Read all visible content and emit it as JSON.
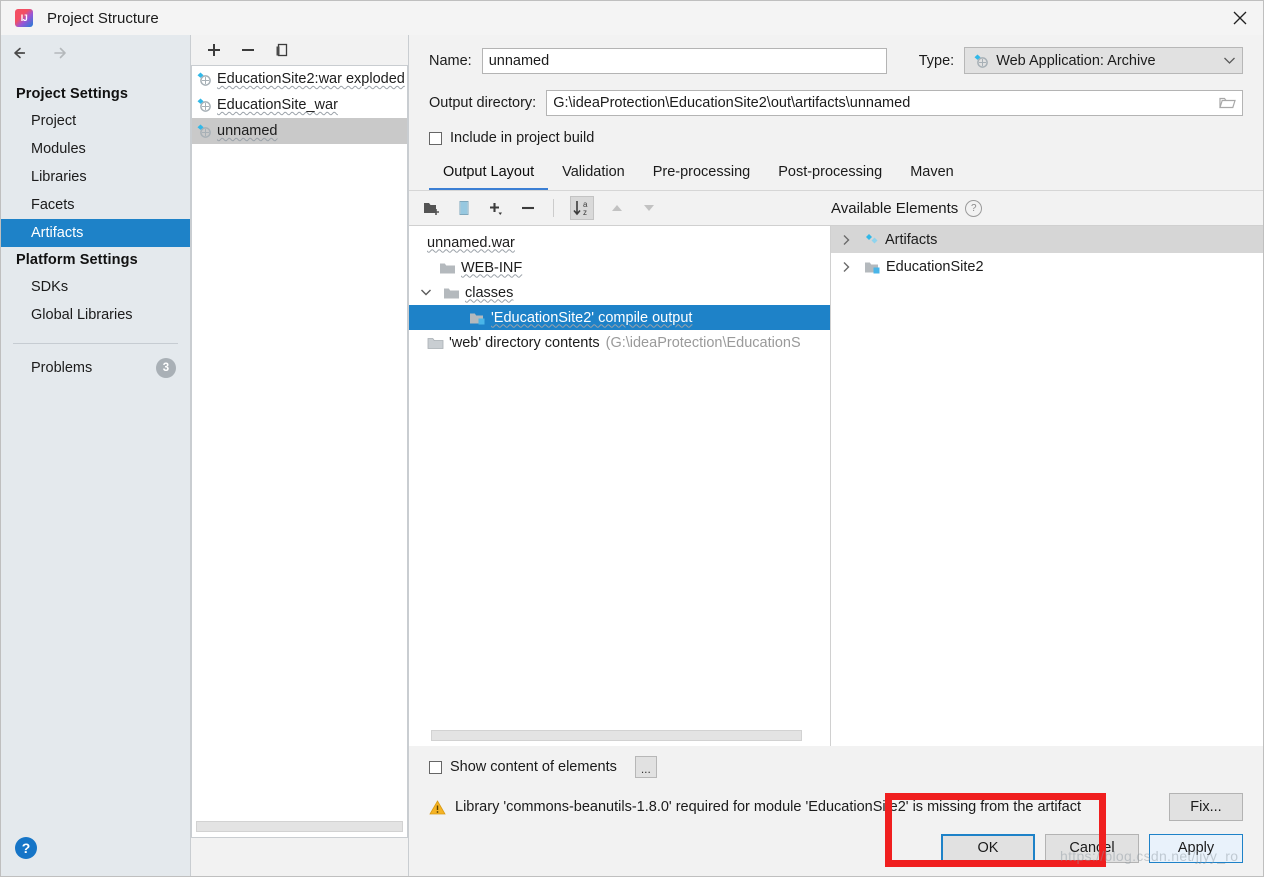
{
  "window": {
    "title": "Project Structure",
    "app_icon": "intellij-idea-icon",
    "close_label": "×"
  },
  "sidebar": {
    "back_label": "Back",
    "forward_label": "Forward",
    "groups": [
      {
        "title": "Project Settings",
        "items": [
          {
            "label": "Project",
            "selected": false
          },
          {
            "label": "Modules",
            "selected": false
          },
          {
            "label": "Libraries",
            "selected": false
          },
          {
            "label": "Facets",
            "selected": false
          },
          {
            "label": "Artifacts",
            "selected": true
          }
        ]
      },
      {
        "title": "Platform Settings",
        "items": [
          {
            "label": "SDKs",
            "selected": false
          },
          {
            "label": "Global Libraries",
            "selected": false
          }
        ]
      }
    ],
    "problems": {
      "label": "Problems",
      "count": "3"
    },
    "help_label": "?",
    "selection_color": "#1e82c8"
  },
  "artifacts_panel": {
    "toolbar": [
      {
        "name": "add-artifact-button",
        "label": "+"
      },
      {
        "name": "remove-artifact-button",
        "label": "−"
      },
      {
        "name": "copy-artifact-button",
        "label": "Copy"
      }
    ],
    "items": [
      {
        "label": "EducationSite2:war exploded",
        "selected": false
      },
      {
        "label": "EducationSite_war",
        "selected": false
      },
      {
        "label": "unnamed",
        "selected": true
      }
    ]
  },
  "form": {
    "name_label": "Name:",
    "name_value": "unnamed",
    "type_label": "Type:",
    "type_value": "Web Application: Archive",
    "output_dir_label": "Output directory:",
    "output_dir_value": "G:\\ideaProtection\\EducationSite2\\out\\artifacts\\unnamed",
    "include_in_build_label": "Include in project build",
    "include_in_build_checked": false
  },
  "tabs": [
    {
      "label": "Output Layout",
      "active": true
    },
    {
      "label": "Validation",
      "active": false
    },
    {
      "label": "Pre-processing",
      "active": false
    },
    {
      "label": "Post-processing",
      "active": false
    },
    {
      "label": "Maven",
      "active": false
    }
  ],
  "layout_toolbar": [
    {
      "name": "create-directory-button",
      "label": "Create Directory"
    },
    {
      "name": "create-archive-button",
      "label": "Create Archive"
    },
    {
      "name": "add-copy-of-button",
      "label": "Add Copy of"
    },
    {
      "name": "remove-element-button",
      "label": "Remove"
    },
    {
      "name": "sort-alphabetically-button",
      "label": "Sort by Name",
      "active": true
    },
    {
      "name": "move-up-button",
      "label": "Move Up",
      "disabled": true
    },
    {
      "name": "move-down-button",
      "label": "Move Down",
      "disabled": true
    }
  ],
  "output_tree": [
    {
      "label": "unnamed.war",
      "indent": 0,
      "icon": "archive-icon",
      "twisty": "",
      "selected": false,
      "path": ""
    },
    {
      "label": "WEB-INF",
      "indent": 1,
      "icon": "folder-icon",
      "twisty": "",
      "selected": false,
      "path": ""
    },
    {
      "label": "classes",
      "indent": 1,
      "icon": "folder-icon",
      "twisty": "expanded",
      "selected": false,
      "path": ""
    },
    {
      "label": "'EducationSite2' compile output",
      "indent": 3,
      "icon": "module-output-icon",
      "twisty": "",
      "selected": true,
      "path": ""
    },
    {
      "label": "'web' directory contents",
      "indent": 0,
      "icon": "directory-contents-icon",
      "twisty": "",
      "selected": false,
      "path": "(G:\\ideaProtection\\EducationS"
    }
  ],
  "available_elements": {
    "title": "Available Elements",
    "help_label": "?",
    "items": [
      {
        "label": "Artifacts",
        "icon": "artifact-icon",
        "twisty": "collapsed",
        "highlighted": true
      },
      {
        "label": "EducationSite2",
        "icon": "module-output-icon",
        "twisty": "collapsed",
        "highlighted": false
      }
    ]
  },
  "bottom": {
    "show_content_label": "Show content of elements",
    "show_content_checked": false,
    "ellipsis_label": "...",
    "warning_icon": "warning-triangle-icon",
    "warning_text": "Library 'commons-beanutils-1.8.0' required for module 'EducationSite2' is missing from the artifact",
    "fix_label": "Fix...",
    "ok_label": "OK",
    "cancel_label": "Cancel",
    "apply_label": "Apply"
  },
  "annotation": {
    "highlight_color": "#f01f1f",
    "watermark_text": "https://blog.csdn.net/jjyy_ro"
  }
}
